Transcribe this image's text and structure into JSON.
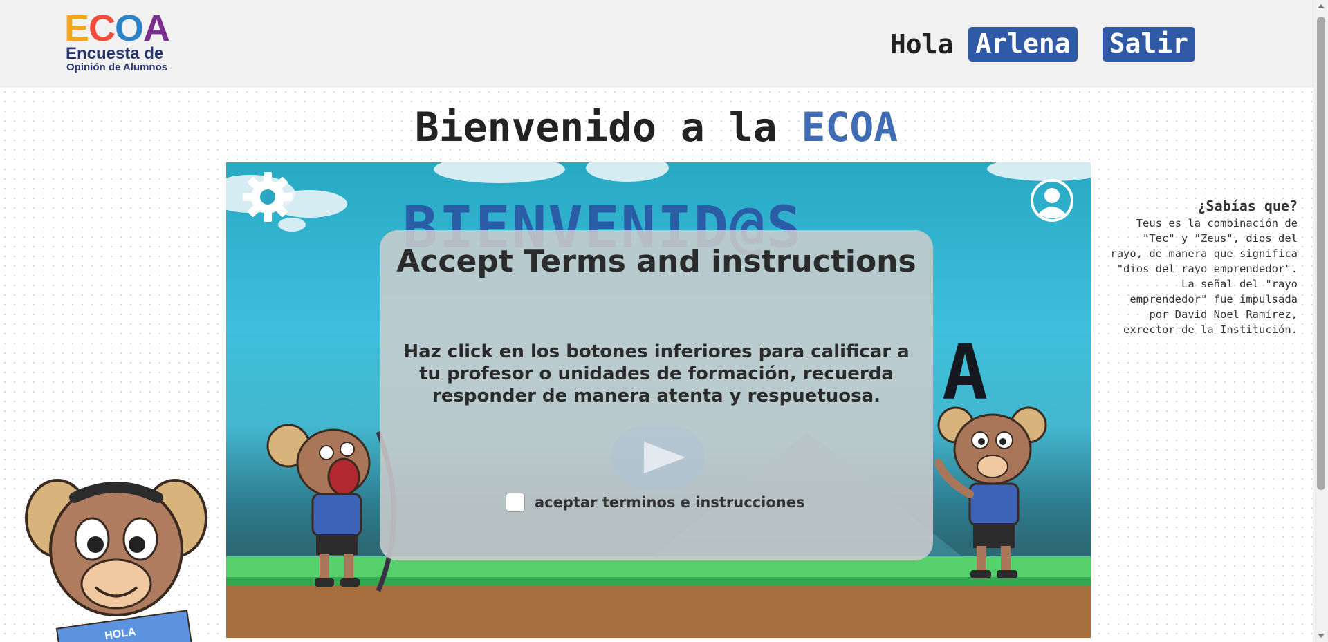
{
  "header": {
    "logo": {
      "letters": [
        "E",
        "C",
        "O",
        "A"
      ],
      "letter_colors": [
        "#f2a71e",
        "#ef4f3a",
        "#2e82c6",
        "#7a2f8e"
      ],
      "line1": "Encuesta de",
      "line2": "Opinión de Alumnos"
    },
    "greeting": "Hola",
    "user_name": "Arlena",
    "logout_label": "Salir"
  },
  "page": {
    "title_prefix": "Bienvenido a la",
    "title_highlight": "ECOA",
    "accent_color": "#3e6db5"
  },
  "game": {
    "banner_text": "BIENVENID@S",
    "settings_icon": "gear-icon",
    "profile_icon": "user-icon"
  },
  "modal": {
    "title": "Accept Terms and instructions",
    "instructions": "Haz click en los botones inferiores para calificar a tu profesor o unidades de formación, recuerda responder de manera atenta y respuetuosa.",
    "play_icon": "play-icon",
    "checkbox_label": "aceptar terminos e instrucciones"
  },
  "fact": {
    "title": "¿Sabías que?",
    "body": "Teus es la combinación de \"Tec\" y \"Zeus\", dios del rayo, de manera que significa \"dios del rayo emprendedor\". La señal del \"rayo emprendedor\" fue impulsada por David Noel Ramírez, exrector de la Institución."
  },
  "mascot": {
    "sign_text": "HOLA"
  }
}
